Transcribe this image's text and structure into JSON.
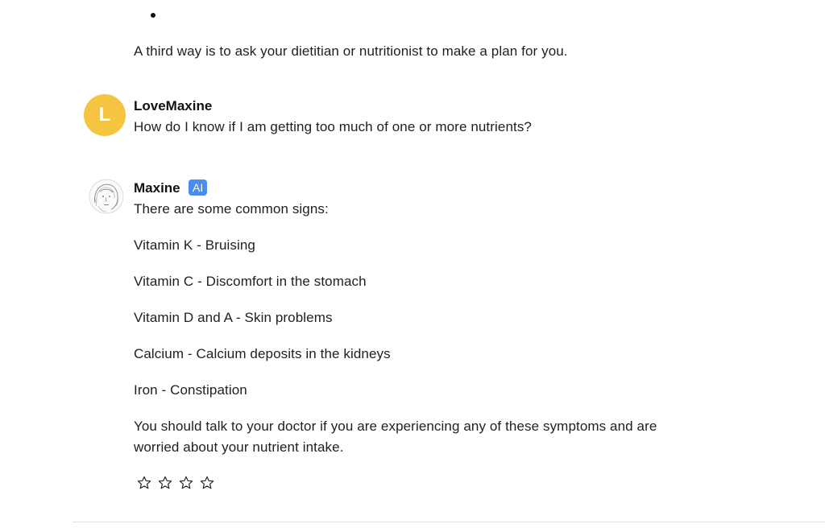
{
  "thread": {
    "previous_text": "A third way is to ask your dietitian or nutritionist to make a plan for you."
  },
  "user_message": {
    "avatar_letter": "L",
    "avatar_color": "#f5c542",
    "username": "LoveMaxine",
    "text": "How do I know if I am getting too much of one or more nutrients?"
  },
  "ai_message": {
    "name": "Maxine",
    "badge": "AI",
    "badge_color": "#4a8cf0",
    "lines": [
      "There are some common signs:",
      "Vitamin K - Bruising",
      "Vitamin C - Discomfort in the stomach",
      "Vitamin D and A - Skin problems",
      "Calcium - Calcium deposits in the kidneys",
      "Iron - Constipation"
    ],
    "closing_line_1": "You should talk to your doctor if you are experiencing any of these symptoms and are",
    "closing_line_2": "worried about your nutrient intake.",
    "rating_stars": 4,
    "rating_icon": "star-outline-icon"
  }
}
